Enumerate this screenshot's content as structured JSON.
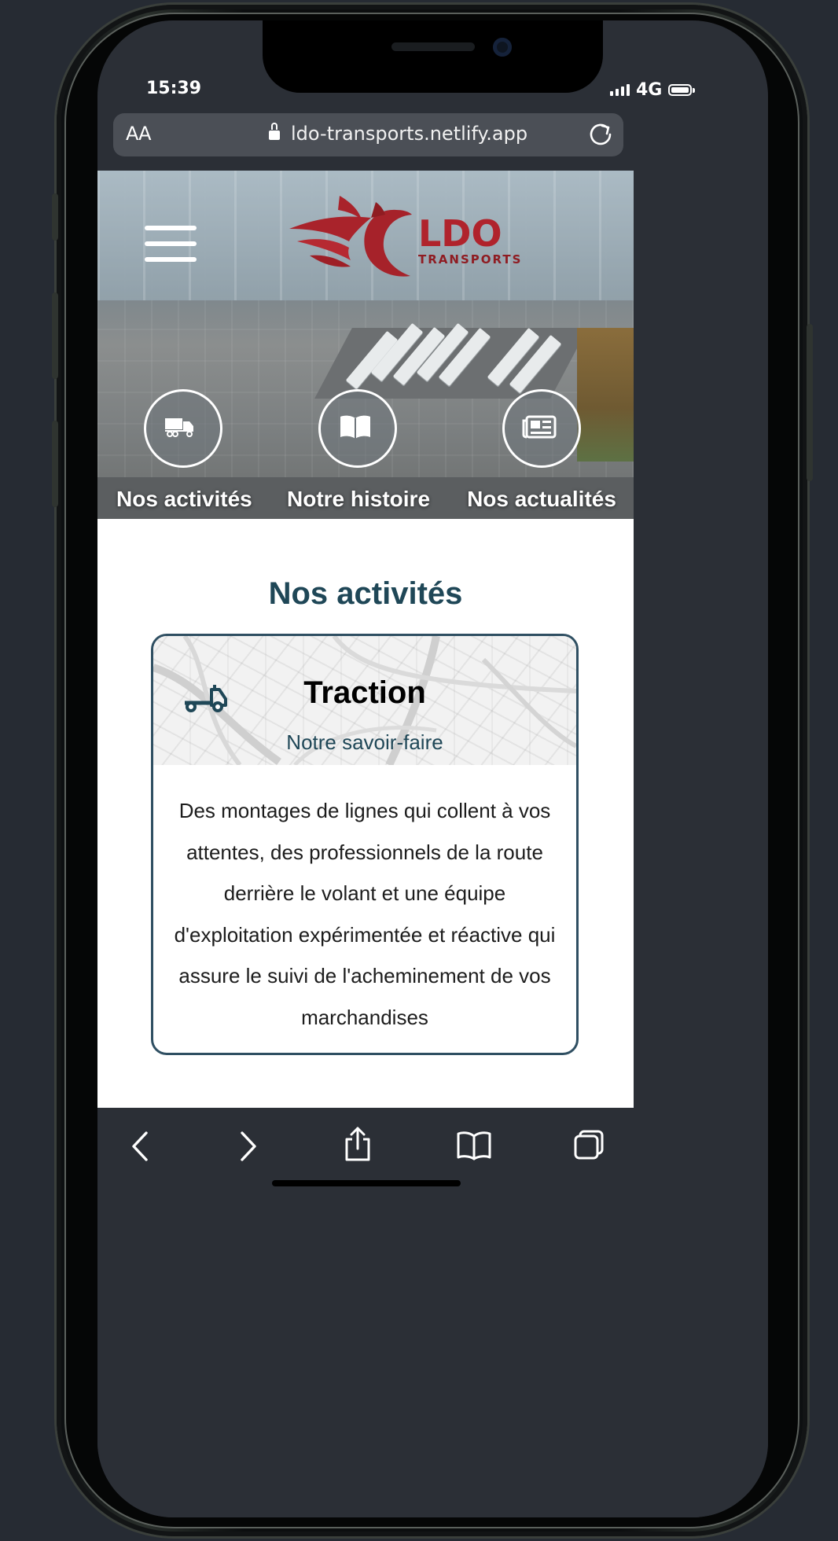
{
  "status_bar": {
    "time": "15:39",
    "network": "4G",
    "signal_icon": "signal-bars-icon",
    "battery_icon": "battery-full-icon"
  },
  "browser": {
    "text_size_label": "AA",
    "url": "ldo-transports.netlify.app",
    "lock_icon": "lock-icon",
    "reload_icon": "reload-icon"
  },
  "header": {
    "menu_icon": "hamburger-menu-icon",
    "logo_name": "LDO TRANSPORTS logo",
    "logo_text": "LDO",
    "logo_subtext": "TRANSPORTS"
  },
  "nav": {
    "items": [
      {
        "label": "Nos activités",
        "icon": "truck-icon"
      },
      {
        "label": "Notre histoire",
        "icon": "open-book-icon"
      },
      {
        "label": "Nos actualités",
        "icon": "newspaper-icon"
      }
    ]
  },
  "section": {
    "title": "Nos activités",
    "card": {
      "icon": "tow-truck-icon",
      "title": "Traction",
      "subtitle": "Notre savoir-faire",
      "body": "Des montages de lignes qui collent à vos attentes, des professionnels de la route derrière le volant et une équipe d'exploitation expérimentée et réactive qui assure le suivi de l'acheminement de vos marchandises"
    }
  },
  "toolbar": {
    "back_icon": "chevron-left-icon",
    "forward_icon": "chevron-right-icon",
    "share_icon": "share-icon",
    "bookmarks_icon": "book-icon",
    "tabs_icon": "tabs-icon"
  },
  "colors": {
    "page_background": "#262b33",
    "accent_blue": "#1f4757",
    "card_border": "#2f4f62",
    "logo_red": "#b0232c",
    "browser_chrome": "#2b2f36",
    "url_bar": "#4b4f56"
  }
}
